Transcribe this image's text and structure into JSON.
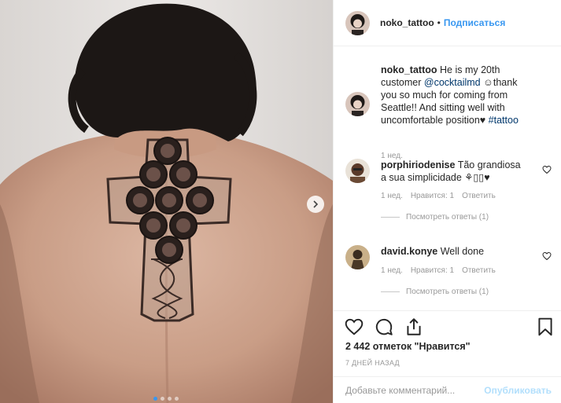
{
  "post": {
    "author": "noko_tattoo",
    "separator": "•",
    "follow_label": "Подписаться",
    "caption": {
      "username": "noko_tattoo",
      "text_1": " He is my 20th customer ",
      "mention": "@cocktailmd",
      "text_2": " ☺thank you so much for coming from Seattle!! And sitting well with uncomfortable position♥ ",
      "hashtag": "#tattoo",
      "time": "1 нед."
    },
    "comments": [
      {
        "username": "porphiriodenise",
        "text": " Tão grandiosa a sua simplicidade ⚘▯▯♥",
        "time": "1 нед.",
        "likes": "Нравится: 1",
        "reply_label": "Ответить",
        "view_replies": "Посмотреть ответы (1)"
      },
      {
        "username": "david.konye",
        "text": " Well done",
        "time": "1 нед.",
        "likes": "Нравится: 1",
        "reply_label": "Ответить",
        "view_replies": "Посмотреть ответы (1)"
      }
    ],
    "likes_text": "2 442 отметок \"Нравится\"",
    "date": "7 ДНЕЙ НАЗАД",
    "comment_placeholder": "Добавьте комментарий...",
    "publish_label": "Опубликовать",
    "carousel": {
      "total": 4,
      "active": 1
    },
    "icons": [
      "heart-icon",
      "comment-icon",
      "share-icon",
      "bookmark-icon",
      "chevron-right-icon"
    ],
    "colors": {
      "link": "#3897f0",
      "publish_disabled": "#b2dffc",
      "meta": "#999999"
    }
  }
}
